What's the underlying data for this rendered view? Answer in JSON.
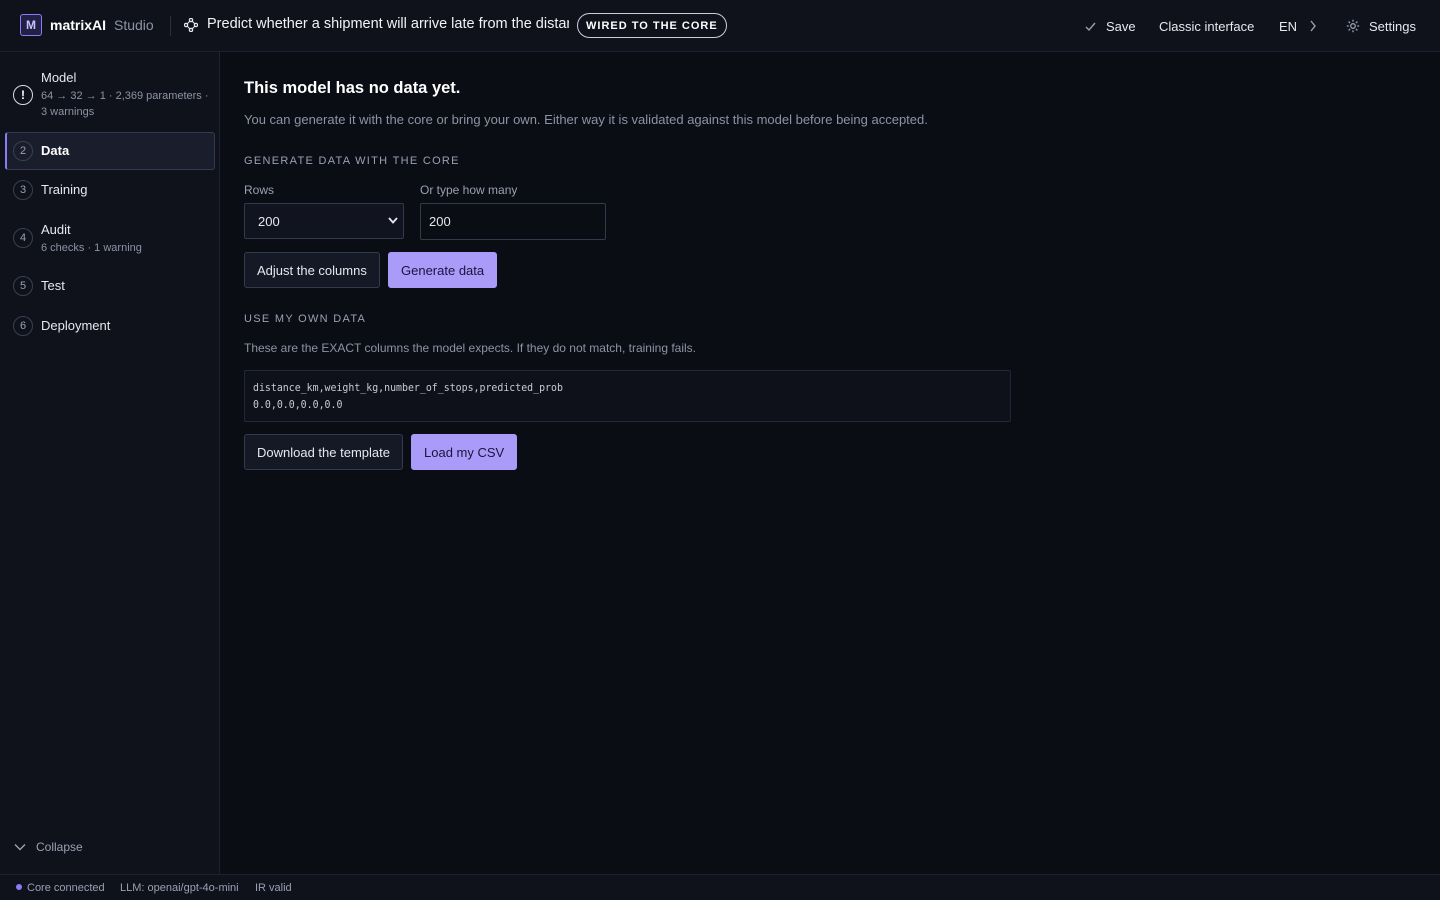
{
  "header": {
    "logo_letter": "M",
    "brand": "matrixAI",
    "brand_sub": "Studio",
    "model_title": "Predict whether a shipment will arrive late from the distance",
    "badge": "WIRED TO THE CORE",
    "save_label": "Save",
    "classic_label": "Classic interface",
    "lang_label": "EN",
    "settings_label": "Settings"
  },
  "sidebar": {
    "steps": [
      {
        "num": "!",
        "label": "Model",
        "sub": "64 → 32 → 1 · 2,369 parameters · 3 warnings",
        "state": "warning"
      },
      {
        "num": "2",
        "label": "Data",
        "sub": "",
        "state": "active"
      },
      {
        "num": "3",
        "label": "Training",
        "sub": "",
        "state": ""
      },
      {
        "num": "4",
        "label": "Audit",
        "sub": "6 checks · 1 warning",
        "state": ""
      },
      {
        "num": "5",
        "label": "Test",
        "sub": "",
        "state": ""
      },
      {
        "num": "6",
        "label": "Deployment",
        "sub": "",
        "state": ""
      }
    ],
    "collapse_label": "Collapse"
  },
  "main": {
    "title": "This model has no data yet.",
    "intro": "You can generate it with the core or bring your own. Either way it is validated against this model before being accepted.",
    "generate": {
      "section_label": "GENERATE DATA WITH THE CORE",
      "rows_label": "Rows",
      "rows_value": "200",
      "custom_label": "Or type how many",
      "custom_value": "200",
      "adjust_button": "Adjust the columns",
      "generate_button": "Generate data"
    },
    "own": {
      "section_label": "USE MY OWN DATA",
      "description": "These are the EXACT columns the model expects. If they do not match, training fails.",
      "csv_header": "distance_km,weight_kg,number_of_stops,predicted_prob",
      "csv_row": "0.0,0.0,0.0,0.0",
      "download_button": "Download the template",
      "load_button": "Load my CSV"
    }
  },
  "status": {
    "core": "Core connected",
    "llm": "LLM: openai/gpt-4o-mini",
    "ir": "IR valid"
  },
  "colors": {
    "accent": "#8b7cf6",
    "primary_button": "#a99bf7",
    "background": "#0b0d14",
    "panel": "#0f121b"
  }
}
